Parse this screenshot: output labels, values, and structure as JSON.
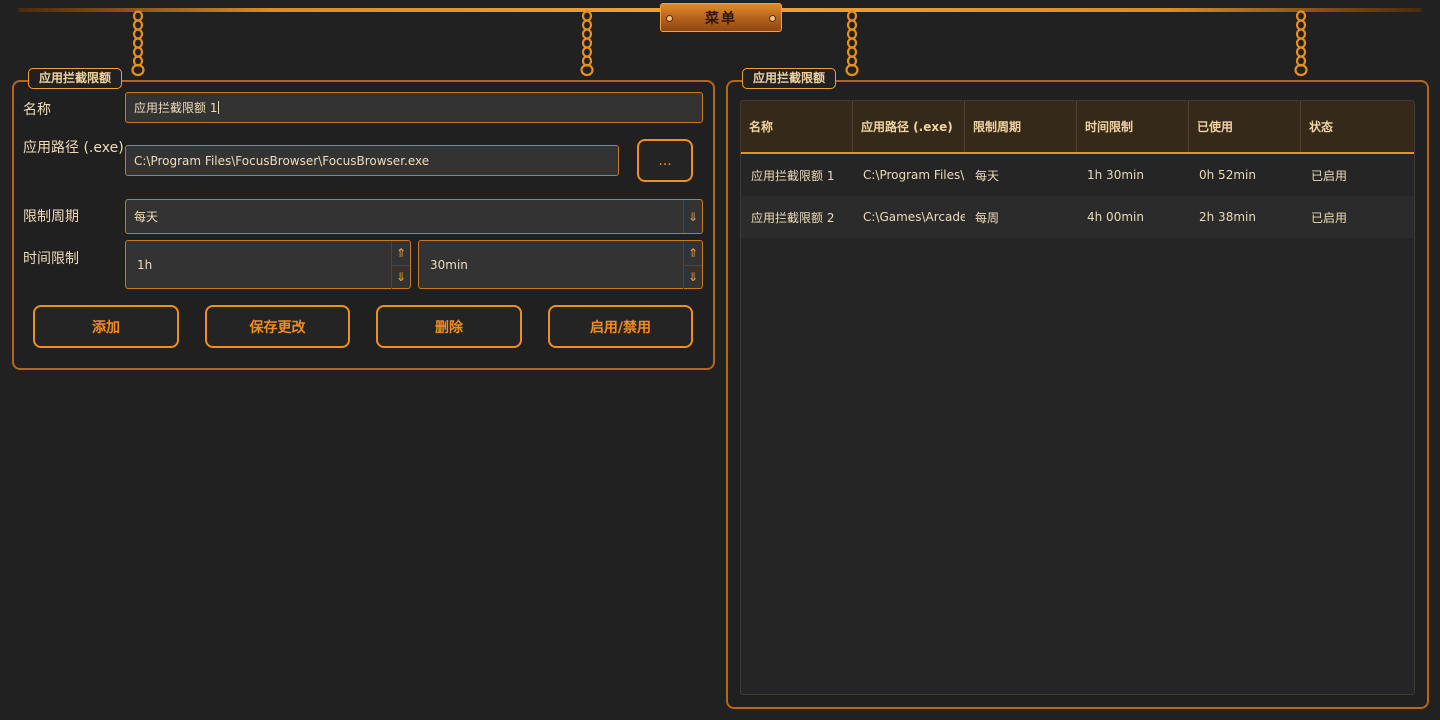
{
  "menu": {
    "label": "菜单"
  },
  "form_panel": {
    "title": "应用拦截限额",
    "name_label": "名称",
    "name_value": "应用拦截限额 1",
    "path_label": "应用路径 (.exe)",
    "path_value": "C:\\Program Files\\FocusBrowser\\FocusBrowser.exe",
    "browse_label": "...",
    "period_label": "限制周期",
    "period_value": "每天",
    "time_label": "时间限制",
    "hours_value": "1h",
    "minutes_value": "30min",
    "buttons": {
      "add": "添加",
      "save": "保存更改",
      "delete": "删除",
      "toggle": "启用/禁用"
    }
  },
  "list_panel": {
    "title": "应用拦截限额",
    "columns": [
      "名称",
      "应用路径 (.exe)",
      "限制周期",
      "时间限制",
      "已使用",
      "状态"
    ],
    "rows": [
      [
        "应用拦截限额 1",
        "C:\\Program Files\\FocusBrowser\\FocusBrowser.exe",
        "每天",
        "1h 30min",
        "0h 52min",
        "已启用"
      ],
      [
        "应用拦截限额 2",
        "C:\\Games\\Arcade\\Arcade.exe",
        "每周",
        "4h 00min",
        "2h 38min",
        "已启用"
      ]
    ]
  },
  "icons": {
    "dropdown": "arrow-down-icon",
    "spin_up": "arrow-up-icon",
    "spin_down": "arrow-down-icon",
    "chain": "chain-icon"
  },
  "colors": {
    "accent": "#ef8f20",
    "background": "#212121",
    "text": "#f0dcb8"
  }
}
